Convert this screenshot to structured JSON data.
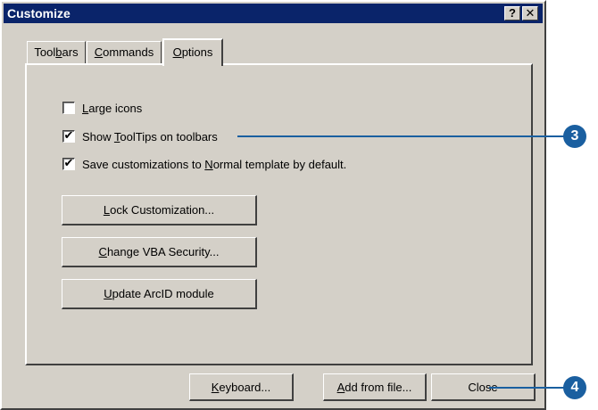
{
  "window": {
    "title": "Customize",
    "help_glyph": "?",
    "close_glyph": "✕"
  },
  "tabs": [
    {
      "label_pre": "Tool",
      "label_u": "b",
      "label_post": "ars",
      "active": false
    },
    {
      "label_pre": "",
      "label_u": "C",
      "label_post": "ommands",
      "active": false
    },
    {
      "label_pre": "",
      "label_u": "O",
      "label_post": "ptions",
      "active": true
    }
  ],
  "options": {
    "checkboxes": [
      {
        "label_pre": "",
        "label_u": "L",
        "label_post": "arge icons",
        "checked": false
      },
      {
        "label_pre": "Show ",
        "label_u": "T",
        "label_post": "oolTips on toolbars",
        "checked": true
      },
      {
        "label_pre": "Save customizations to ",
        "label_u": "N",
        "label_post": "ormal template by default.",
        "checked": true
      }
    ],
    "buttons": [
      {
        "label_pre": "",
        "label_u": "L",
        "label_post": "ock Customization..."
      },
      {
        "label_pre": "",
        "label_u": "C",
        "label_post": "hange VBA Security..."
      },
      {
        "label_pre": "",
        "label_u": "U",
        "label_post": "pdate ArcID module"
      }
    ]
  },
  "footer": {
    "buttons": [
      {
        "label_pre": "",
        "label_u": "K",
        "label_post": "eyboard..."
      },
      {
        "label_pre": "",
        "label_u": "A",
        "label_post": "dd from file..."
      },
      {
        "label_pre": "Close",
        "label_u": "",
        "label_post": ""
      }
    ]
  },
  "callouts": [
    "3",
    "4"
  ],
  "check_glyph": "✔",
  "colors": {
    "titlebar": "#0a246a",
    "face": "#d4d0c8",
    "callout": "#1a5fa0"
  }
}
